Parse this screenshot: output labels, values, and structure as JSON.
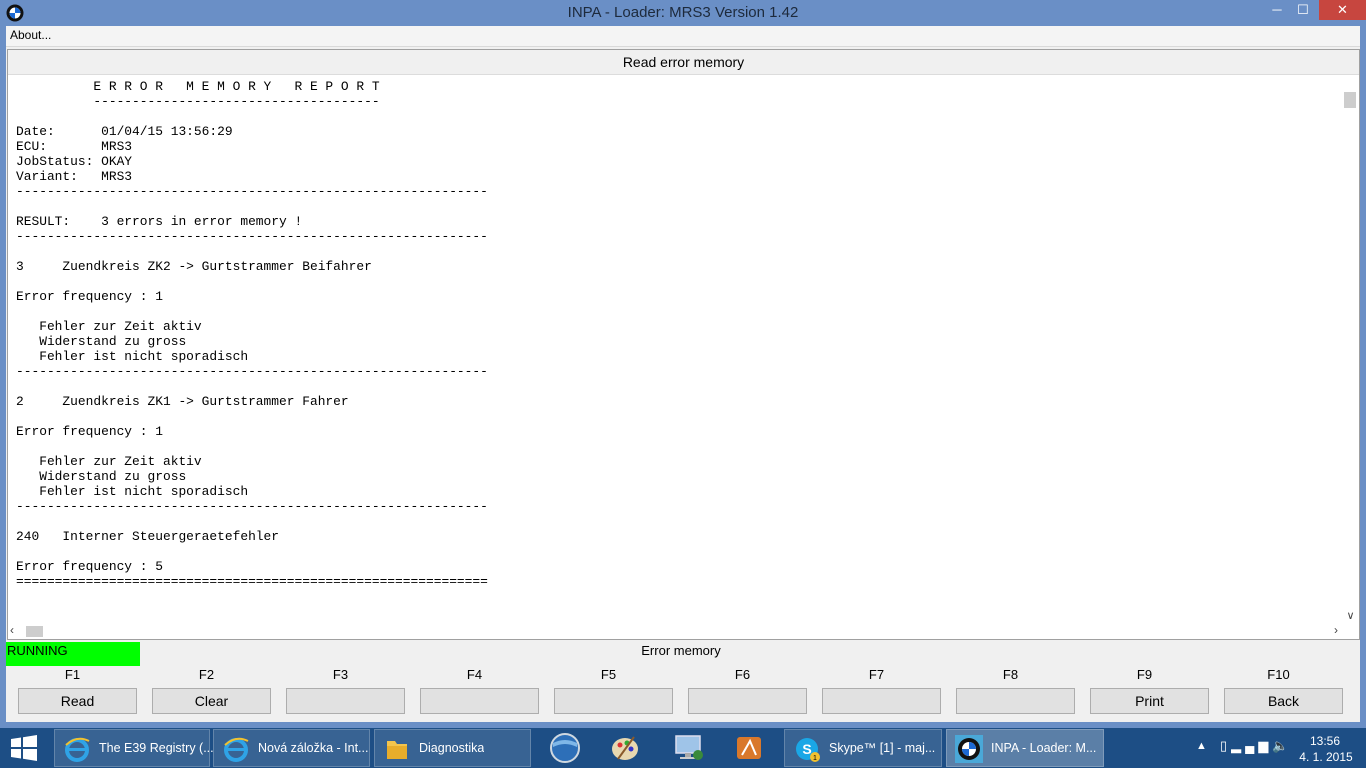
{
  "window": {
    "title": "INPA - Loader:  MRS3 Version 1.42",
    "min_glyph": "─",
    "max_glyph": "☐",
    "close_glyph": "✕"
  },
  "menu": {
    "about": "About..."
  },
  "panel": {
    "title": "Read error memory",
    "report": "          E R R O R   M E M O R Y   R E P O R T\n          -------------------------------------\n\nDate:      01/04/15 13:56:29\nECU:       MRS3\nJobStatus: OKAY\nVariant:   MRS3\n-------------------------------------------------------------\n\nRESULT:    3 errors in error memory !\n-------------------------------------------------------------\n\n3     Zuendkreis ZK2 -> Gurtstrammer Beifahrer\n\nError frequency : 1\n\n   Fehler zur Zeit aktiv\n   Widerstand zu gross\n   Fehler ist nicht sporadisch\n-------------------------------------------------------------\n\n2     Zuendkreis ZK1 -> Gurtstrammer Fahrer\n\nError frequency : 1\n\n   Fehler zur Zeit aktiv\n   Widerstand zu gross\n   Fehler ist nicht sporadisch\n-------------------------------------------------------------\n\n240   Interner Steuergeraetefehler\n\nError frequency : 5\n============================================================="
  },
  "status": {
    "running": "RUNNING",
    "label": "Error memory",
    "running_color": "#00ff00"
  },
  "fkeys": [
    {
      "key": "F1",
      "label": "Read"
    },
    {
      "key": "F2",
      "label": "Clear"
    },
    {
      "key": "F3",
      "label": ""
    },
    {
      "key": "F4",
      "label": ""
    },
    {
      "key": "F5",
      "label": ""
    },
    {
      "key": "F6",
      "label": ""
    },
    {
      "key": "F7",
      "label": ""
    },
    {
      "key": "F8",
      "label": ""
    },
    {
      "key": "F9",
      "label": "Print"
    },
    {
      "key": "F10",
      "label": "Back"
    }
  ],
  "taskbar": {
    "tasks": [
      {
        "label": "The E39 Registry (...",
        "icon": "ie-icon"
      },
      {
        "label": "Nová záložka - Int...",
        "icon": "ie-icon"
      },
      {
        "label": "Diagnostika",
        "icon": "folder-icon"
      },
      {
        "label": "Skype™ [1] - maj...",
        "icon": "skype-icon"
      },
      {
        "label": "INPA - Loader:  M...",
        "icon": "bmw-icon"
      }
    ],
    "skype_badge": "1",
    "tray_arrow": "▲",
    "clock_time": "13:56",
    "clock_date": "4. 1. 2015",
    "color": "#1d4e85"
  },
  "colors": {
    "titlebar": "#6a8fc6",
    "close": "#c7463f"
  }
}
